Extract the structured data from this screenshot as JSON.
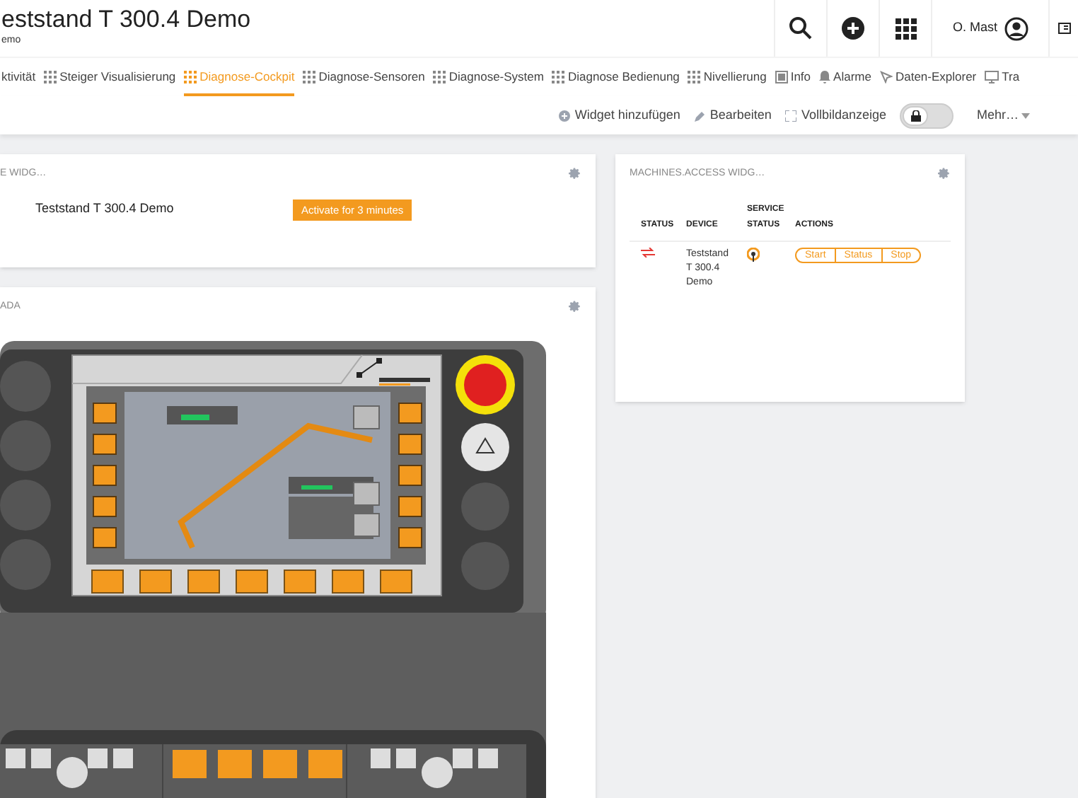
{
  "header": {
    "title": "eststand T 300.4 Demo",
    "subtitle": "emo",
    "user": "O. Mast"
  },
  "tabs": [
    {
      "label": "ktivität",
      "kind": "plain",
      "selected": false
    },
    {
      "label": "Steiger Visualisierung",
      "kind": "grid",
      "selected": false
    },
    {
      "label": "Diagnose-Cockpit",
      "kind": "grid",
      "selected": true
    },
    {
      "label": "Diagnose-Sensoren",
      "kind": "grid",
      "selected": false
    },
    {
      "label": "Diagnose-System",
      "kind": "grid",
      "selected": false
    },
    {
      "label": "Diagnose Bedienung",
      "kind": "grid",
      "selected": false
    },
    {
      "label": "Nivellierung",
      "kind": "grid",
      "selected": false
    },
    {
      "label": "Info",
      "kind": "box",
      "selected": false
    },
    {
      "label": "Alarme",
      "kind": "bell",
      "selected": false
    },
    {
      "label": "Daten-Explorer",
      "kind": "explore",
      "selected": false
    },
    {
      "label": "Tra",
      "kind": "monitor",
      "selected": false
    }
  ],
  "toolbar": {
    "actions": [
      {
        "label": "Widget hinzufügen",
        "kind": "plus"
      },
      {
        "label": "Bearbeiten",
        "kind": "pencil"
      },
      {
        "label": "Vollbildanzeige",
        "kind": "expand"
      }
    ],
    "lock_toggle": {
      "locked": true
    },
    "more": "Mehr…"
  },
  "activation_widget": {
    "title": "E WIDG…",
    "device": "Teststand T 300.4 Demo",
    "button": "Activate for 3 minutes"
  },
  "scada_widget": {
    "title": "ADA"
  },
  "access_widget": {
    "title": "MACHINES.ACCESS WIDG…",
    "columns": [
      "STATUS",
      "DEVICE",
      "SERVICE\nSTATUS",
      "ACTIONS"
    ],
    "rows": [
      {
        "device": "Teststand\nT 300.4\nDemo",
        "actions": [
          "Start",
          "Status",
          "Stop"
        ]
      }
    ]
  }
}
